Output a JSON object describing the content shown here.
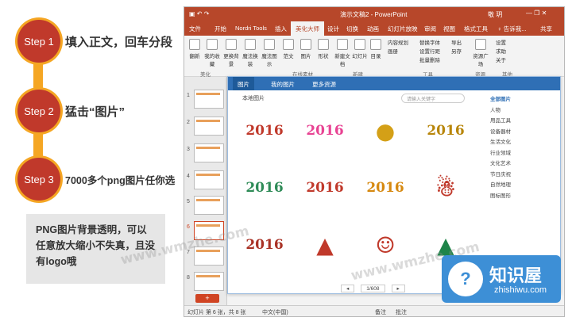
{
  "steps": [
    {
      "label": "Step 1",
      "text": "填入正文，回车分段"
    },
    {
      "label": "Step 2",
      "text": "猛击“图片”"
    },
    {
      "label": "Step 3",
      "text": "7000多个png图片任你选"
    }
  ],
  "note": "PNG图片背景透明，可以任意放大缩小不失真，且没有logo哦",
  "window": {
    "title": "演示文稿2  -  PowerPoint",
    "user": "敬 玥",
    "tabs": [
      "文件",
      "开始",
      "Nordri Tools",
      "插入",
      "美化大师",
      "设计",
      "切换",
      "动画",
      "幻灯片放映",
      "审阅",
      "视图",
      "格式工具",
      "♀ 告诉我...",
      "共享"
    ],
    "active_tab": "美化大师",
    "ribbon": {
      "buttons": [
        "翻新",
        "我的收藏",
        "更换背景",
        "魔法换装",
        "魔法图示",
        "范文",
        "图片",
        "形状",
        "新建文档",
        "幻灯片",
        "目录",
        "资源广场"
      ],
      "small": [
        "内容规划",
        "画册",
        "替换字体",
        "设置行距",
        "批量删除",
        "导出",
        "另存",
        "设置",
        "求助",
        "关于"
      ],
      "groups": [
        "美化",
        "在线素材",
        "新建",
        "工具",
        "资源",
        "其他"
      ]
    },
    "slide_numbers": [
      "1",
      "2",
      "3",
      "4",
      "5",
      "6",
      "7",
      "8"
    ],
    "selected_slide": "6",
    "add_label": "+",
    "status": {
      "slide": "幻灯片 第 6 张，共 8 张",
      "lang": "中文(中国)",
      "notes": "备注",
      "comments": "批注"
    }
  },
  "picture_panel": {
    "tabs": [
      "图片",
      "我的图片",
      "更多资源"
    ],
    "active_tab": "图片",
    "local": "本地图片",
    "search_placeholder": "请输入关键字",
    "categories": [
      "全部图片",
      "人物",
      "用品工具",
      "设备器材",
      "生活文化",
      "行业领域",
      "文化艺术",
      "节日庆祝",
      "自然地理",
      "图标图形"
    ],
    "active_category": "全部图片",
    "pager": {
      "prev": "◂",
      "page": "1/608",
      "next": "▸"
    }
  },
  "images": [
    {
      "name": "2016 red script",
      "text": "2016",
      "color": "#c0392b"
    },
    {
      "name": "2016 gradient",
      "text": "2016",
      "color": "#e84393"
    },
    {
      "name": "gold ornament",
      "text": "●",
      "color": "#d4a017"
    },
    {
      "name": "2016 gold ribbon",
      "text": "2016",
      "color": "#b8860b"
    },
    {
      "name": "2016 green",
      "text": "2016",
      "color": "#2e8b57"
    },
    {
      "name": "2016 happy new year",
      "text": "2016",
      "color": "#c0392b"
    },
    {
      "name": "2016 golden 3d",
      "text": "2016",
      "color": "#d68910"
    },
    {
      "name": "snowman",
      "text": "☃",
      "color": "#c0392b"
    },
    {
      "name": "2016 red green",
      "text": "2016",
      "color": "#a93226"
    },
    {
      "name": "santa hat",
      "text": "▲",
      "color": "#c0392b"
    },
    {
      "name": "santa claus",
      "text": "☺",
      "color": "#c0392b"
    },
    {
      "name": "christmas tree",
      "text": "▲",
      "color": "#1e8449"
    }
  ],
  "watermark": "www.wmzhe.com",
  "logo": {
    "brand": "知识屋",
    "domain": "zhishiwu.com"
  },
  "colors": {
    "accent": "#b7472a",
    "step": "#c0392b",
    "track": "#f5a623",
    "panel": "#2f6fb5"
  }
}
